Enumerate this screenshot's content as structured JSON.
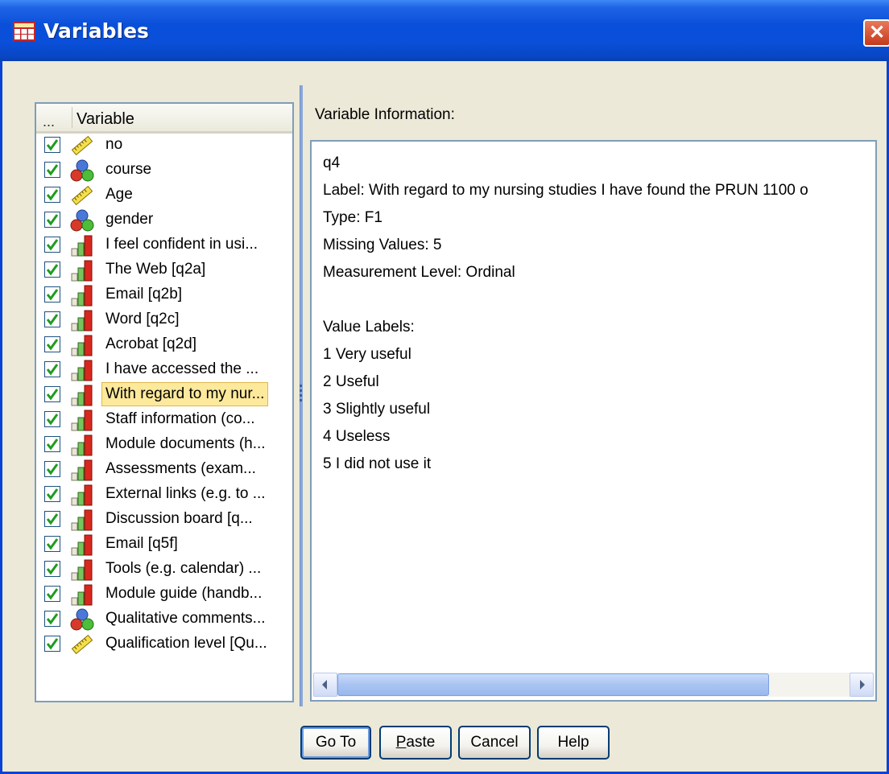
{
  "window": {
    "title": "Variables",
    "close_label": "✕"
  },
  "variable_list": {
    "header_dots": "...",
    "header_label": "Variable",
    "items": [
      {
        "label": "no",
        "type": "scale",
        "checked": true
      },
      {
        "label": "course",
        "type": "nominal",
        "checked": true
      },
      {
        "label": "Age",
        "type": "scale",
        "checked": true
      },
      {
        "label": "gender",
        "type": "nominal",
        "checked": true
      },
      {
        "label": "I feel confident in usi...",
        "type": "ordinal",
        "checked": true
      },
      {
        "label": "The Web [q2a]",
        "type": "ordinal",
        "checked": true
      },
      {
        "label": "Email [q2b]",
        "type": "ordinal",
        "checked": true
      },
      {
        "label": "Word  [q2c]",
        "type": "ordinal",
        "checked": true
      },
      {
        "label": "Acrobat [q2d]",
        "type": "ordinal",
        "checked": true
      },
      {
        "label": "I have accessed the ...",
        "type": "ordinal",
        "checked": true
      },
      {
        "label": "With regard to my nur...",
        "type": "ordinal",
        "checked": true,
        "selected": true
      },
      {
        "label": "Staff information (co...",
        "type": "ordinal",
        "checked": true
      },
      {
        "label": "Module documents (h...",
        "type": "ordinal",
        "checked": true
      },
      {
        "label": "Assessments (exam...",
        "type": "ordinal",
        "checked": true
      },
      {
        "label": "External links (e.g. to ...",
        "type": "ordinal",
        "checked": true
      },
      {
        "label": "Discussion board  [q...",
        "type": "ordinal",
        "checked": true
      },
      {
        "label": "Email [q5f]",
        "type": "ordinal",
        "checked": true
      },
      {
        "label": "Tools (e.g. calendar) ...",
        "type": "ordinal",
        "checked": true
      },
      {
        "label": "Module guide (handb...",
        "type": "ordinal",
        "checked": true
      },
      {
        "label": "Qualitative comments...",
        "type": "nominal",
        "checked": true
      },
      {
        "label": "Qualification level [Qu...",
        "type": "scale",
        "checked": true
      }
    ]
  },
  "info": {
    "heading": "Variable Information:",
    "name": "q4",
    "label_line": "Label:  With regard to my nursing studies I have found the PRUN 1100 o",
    "type_line": "Type:  F1",
    "missing_line": "Missing Values:  5",
    "measurement_line": "Measurement Level:  Ordinal",
    "value_labels_heading": "Value Labels:",
    "value_labels": [
      "1   Very useful",
      "2   Useful",
      "3   Slightly useful",
      "4   Useless",
      "5   I did not use it"
    ]
  },
  "buttons": {
    "goto": "Go To",
    "paste_accel": "P",
    "paste_rest": "aste",
    "cancel": "Cancel",
    "help": "Help"
  },
  "colors": {
    "titlebar": "#0a4fd9",
    "dialog_bg": "#ece9d8",
    "selection": "#fde99b"
  }
}
